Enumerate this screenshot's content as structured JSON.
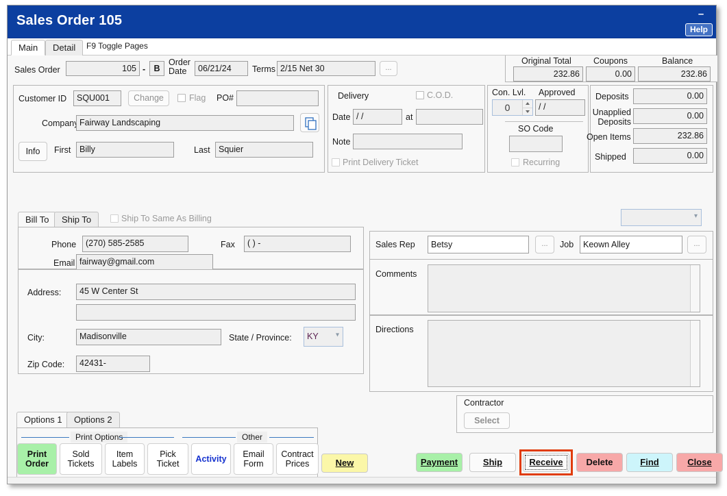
{
  "window": {
    "title": "Sales Order 105",
    "minimize_label": "–",
    "help_label": "Help"
  },
  "tabs": {
    "main": "Main",
    "detail": "Detail",
    "hint": "F9 Toggle Pages"
  },
  "order": {
    "sales_order_label": "Sales Order",
    "sales_order_number": "105",
    "dash": "-",
    "suffix": "B",
    "order_date_label": "Order Date",
    "order_date": "06/21/24",
    "terms_label": "Terms",
    "terms_value": "2/15 Net 30",
    "terms_ellipsis": "..."
  },
  "totals": {
    "original_total_label": "Original Total",
    "original_total": "232.86",
    "coupons_label": "Coupons",
    "coupons": "0.00",
    "balance_label": "Balance",
    "balance": "232.86"
  },
  "customer": {
    "customer_id_label": "Customer ID",
    "customer_id": "SQU001",
    "change_label": "Change",
    "flag_label": "Flag",
    "po_label": "PO#",
    "po_value": "",
    "company_label": "Company",
    "company": "Fairway Landscaping",
    "copy_icon": "copy-icon",
    "info_label": "Info",
    "first_label": "First",
    "first": "Billy",
    "last_label": "Last",
    "last": "Squier"
  },
  "delivery": {
    "title": "Delivery",
    "cod_label": "C.O.D.",
    "date_label": "Date",
    "date_value": "/  /",
    "at_label": "at",
    "at_value": "",
    "note_label": "Note",
    "note_value": "",
    "print_ticket_label": "Print Delivery Ticket"
  },
  "confirm": {
    "con_lvl_label": "Con. Lvl.",
    "con_lvl_value": "0",
    "approved_label": "Approved",
    "approved_value": "/  /",
    "so_code_label": "SO Code",
    "so_code_value": "",
    "recurring_label": "Recurring"
  },
  "deposits": {
    "deposits_label": "Deposits",
    "deposits": "0.00",
    "unapplied_label": "Unapplied Deposits",
    "unapplied": "0.00",
    "open_items_label": "Open Items",
    "open_items": "232.86",
    "shipped_label": "Shipped",
    "shipped": "0.00",
    "dropdown_value": ""
  },
  "address": {
    "bill_to_tab": "Bill To",
    "ship_to_tab": "Ship To",
    "same_as_billing_label": "Ship To Same As Billing",
    "phone_label": "Phone",
    "phone": "(270) 585-2585",
    "fax_label": "Fax",
    "fax": "(    )    -",
    "email_label": "Email",
    "email": "fairway@gmail.com",
    "address_label": "Address:",
    "address1": "45 W Center St",
    "address2": "",
    "city_label": "City:",
    "city": "Madisonville",
    "state_label": "State / Province:",
    "state": "KY",
    "zip_label": "Zip Code:",
    "zip": "42431-"
  },
  "rep": {
    "sales_rep_label": "Sales Rep",
    "sales_rep": "Betsy",
    "rep_ellipsis": "...",
    "job_label": "Job",
    "job": "Keown Alley",
    "job_ellipsis": "...",
    "comments_label": "Comments",
    "comments_value": "",
    "directions_label": "Directions",
    "directions_value": ""
  },
  "contractor": {
    "title": "Contractor",
    "select_label": "Select"
  },
  "options": {
    "tab1": "Options 1",
    "tab2": "Options 2",
    "group_print": "Print Options",
    "group_other": "Other",
    "buttons": [
      {
        "label": "Print Order",
        "style": "green"
      },
      {
        "label": "Sold Tickets",
        "style": "plain"
      },
      {
        "label": "Item Labels",
        "style": "plain"
      },
      {
        "label": "Pick Ticket",
        "style": "plain"
      },
      {
        "label": "Activity",
        "style": "blue"
      },
      {
        "label": "Email Form",
        "style": "plain"
      },
      {
        "label": "Contract Prices",
        "style": "plain"
      }
    ],
    "new_label": "New"
  },
  "actions": {
    "payment": "Payment",
    "ship": "Ship",
    "receive": "Receive",
    "delete": "Delete",
    "find": "Find",
    "close": "Close"
  },
  "colors": {
    "titlebar": "#0c3fa0",
    "accent_green": "#a8f0a8",
    "accent_red": "#f7a8a8",
    "accent_yellow": "#fbf7a8",
    "accent_cyan": "#cdf5fb",
    "highlight": "#e03c0a",
    "separator_blue": "#3a78c0",
    "link_blue": "#1633cf"
  }
}
